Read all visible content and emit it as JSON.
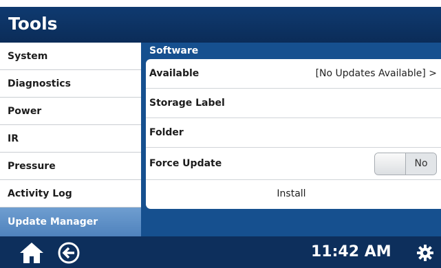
{
  "window": {
    "title": "Tools"
  },
  "sidebar": {
    "items": [
      {
        "label": "System"
      },
      {
        "label": "Diagnostics"
      },
      {
        "label": "Power"
      },
      {
        "label": "IR"
      },
      {
        "label": "Pressure"
      },
      {
        "label": "Activity Log"
      },
      {
        "label": "Update Manager",
        "selected": true
      }
    ]
  },
  "software": {
    "header": "Software",
    "available_label": "Available",
    "available_value": "[No Updates Available] >",
    "storage_label": "Storage Label",
    "folder_label": "Folder",
    "force_update_label": "Force Update",
    "force_update_value": "No",
    "install_label": "Install"
  },
  "footer": {
    "time": "11:42 AM",
    "icons": [
      "home-icon",
      "back-icon",
      "gear-icon"
    ]
  },
  "colors": {
    "header_bg": "#0b2c58",
    "content_bg": "#16508f",
    "selected_bg": "#4f82bd",
    "panel_bg": "#ffffff"
  }
}
